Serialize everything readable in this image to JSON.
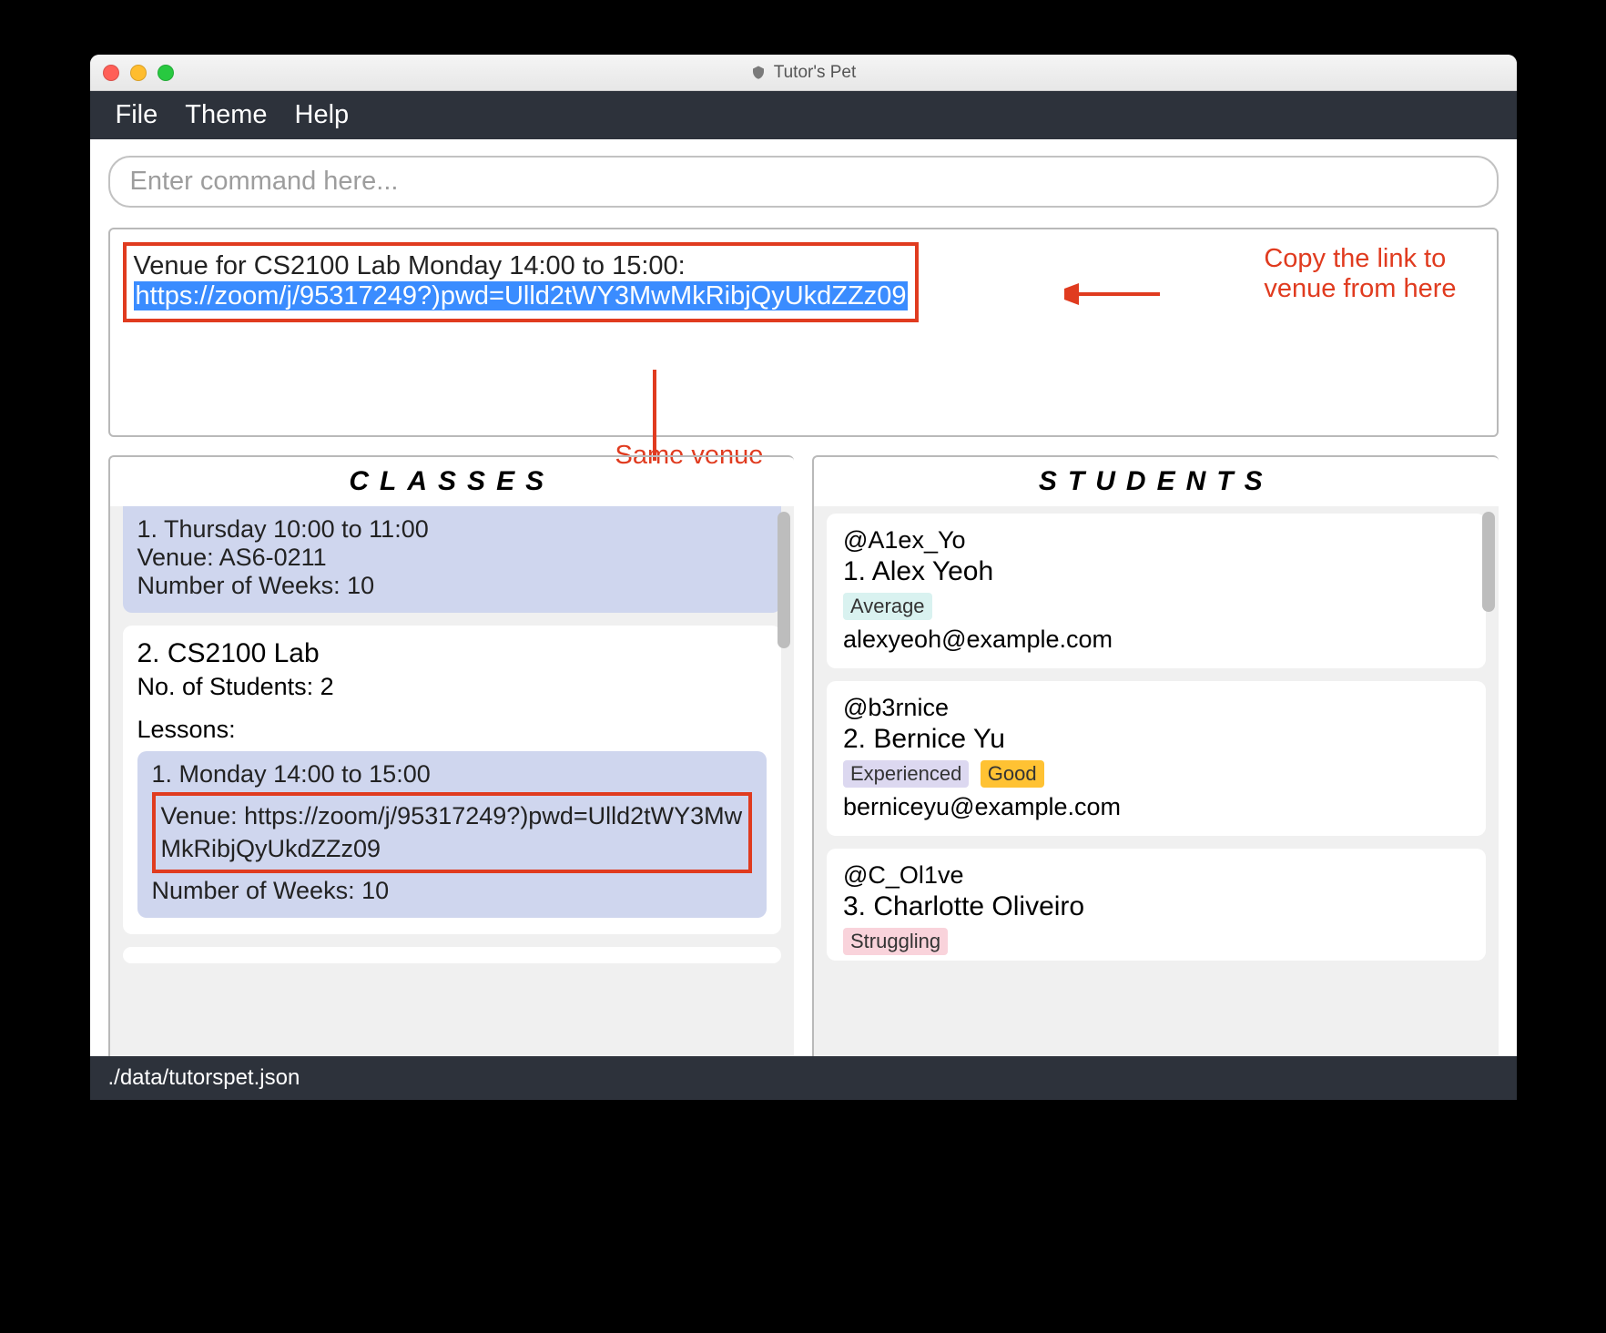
{
  "window": {
    "title": "Tutor's Pet"
  },
  "menubar": {
    "file": "File",
    "theme": "Theme",
    "help": "Help"
  },
  "command": {
    "placeholder": "Enter command here..."
  },
  "result": {
    "line1": "Venue for CS2100 Lab Monday 14:00 to 15:00:",
    "line2": "https://zoom/j/95317249?)pwd=Ulld2tWY3MwMkRibjQyUkdZZz09"
  },
  "annotations": {
    "copy_line1": "Copy the link to",
    "copy_line2": "venue from here",
    "same_venue": "Same venue"
  },
  "panels": {
    "classes": {
      "header": "CLASSES",
      "partial_lesson": {
        "title": "1. Thursday 10:00 to 11:00",
        "venue": "Venue: AS6-0211",
        "weeks": "Number of Weeks: 10"
      },
      "class2": {
        "title": "2.  CS2100 Lab",
        "students": "No. of Students:  2",
        "lessons_label": "Lessons:",
        "lesson1": {
          "title": "1. Monday 14:00 to 15:00",
          "venue_label": "Venue:",
          "venue_url": "https://zoom/j/95317249?)pwd=Ulld2tWY3MwMkRibjQyUkdZZz09",
          "weeks": "Number of Weeks: 10"
        }
      }
    },
    "students": {
      "header": "STUDENTS",
      "list": [
        {
          "handle": "@A1ex_Yo",
          "name": "1.  Alex Yeoh",
          "tags": [
            {
              "text": "Average",
              "cls": "tag-average"
            }
          ],
          "email": "alexyeoh@example.com"
        },
        {
          "handle": "@b3rnice",
          "name": "2.  Bernice Yu",
          "tags": [
            {
              "text": "Experienced",
              "cls": "tag-exp"
            },
            {
              "text": "Good",
              "cls": "tag-good"
            }
          ],
          "email": "berniceyu@example.com"
        },
        {
          "handle": "@C_Ol1ve",
          "name": "3.  Charlotte Oliveiro",
          "tags": [
            {
              "text": "Struggling",
              "cls": "tag-struggle"
            }
          ],
          "email": ""
        }
      ]
    }
  },
  "statusbar": {
    "path": "./data/tutorspet.json"
  }
}
